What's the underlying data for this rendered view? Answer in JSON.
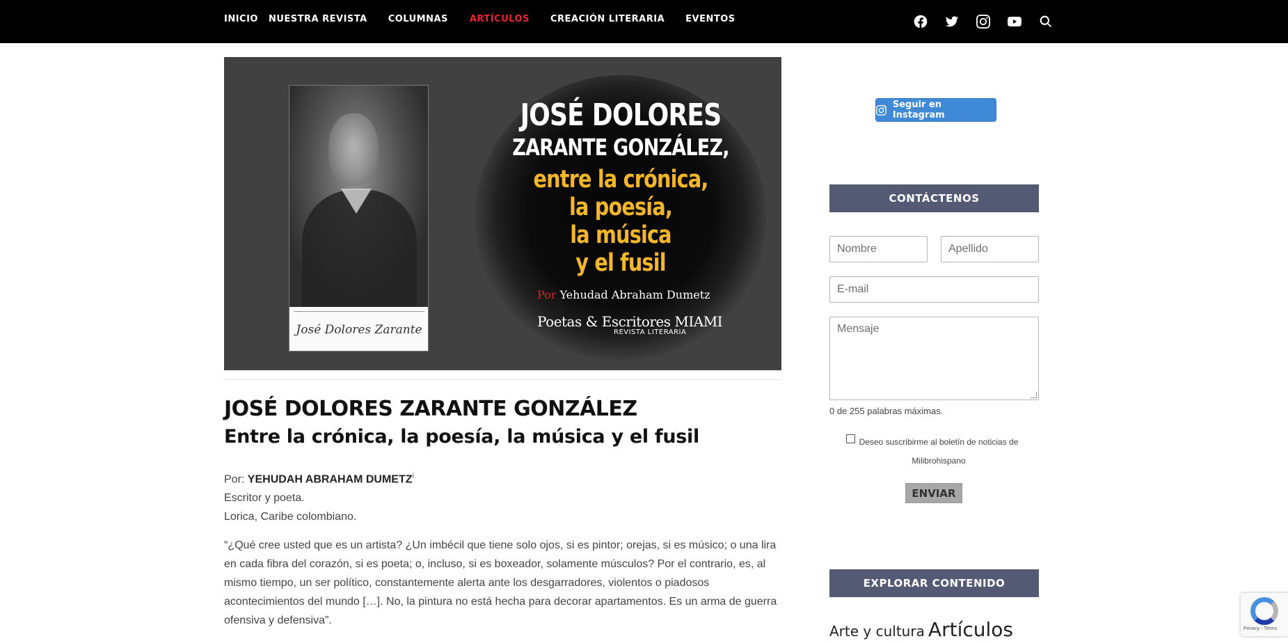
{
  "nav": {
    "items": [
      {
        "label": "INICIO",
        "active": false
      },
      {
        "label": "NUESTRA REVISTA",
        "active": false
      },
      {
        "label": "COLUMNAS",
        "active": false
      },
      {
        "label": "ARTÍCULOS",
        "active": true
      },
      {
        "label": "CREACIÓN LITERARIA",
        "active": false
      },
      {
        "label": "EVENTOS",
        "active": false
      }
    ],
    "icons": [
      "facebook-icon",
      "twitter-icon",
      "instagram-icon",
      "youtube-icon",
      "search-icon"
    ],
    "active_color": "#e3262f"
  },
  "hero": {
    "line1": "JOSÉ DOLORES",
    "line2": "ZARANTE GONZÁLEZ,",
    "line3": "entre la crónica,",
    "line4": "la poesía,",
    "line5": "la música",
    "line6": "y el fusil",
    "by_prefix": "Por",
    "by_name": "Yehudad Abraham Dumetz",
    "logo_main": "Poetas & Escritores MIAMI",
    "logo_sub": "REVISTA LITERARIA",
    "signature": "José Dolores Zarante",
    "accent_color": "#f5b629"
  },
  "article": {
    "title": "JOSÉ DOLORES ZARANTE GONZÁLEZ",
    "subtitle": "Entre la crónica, la poesía, la música y el fusil",
    "by_label": "Por:",
    "author": "YEHUDAH ABRAHAM DUMETZ",
    "author_note": "i",
    "role": "Escritor y poeta.",
    "location": "Lorica, Caribe colombiano.",
    "quote": "“¿Qué cree usted que es un artista? ¿Un imbécil que tiene solo ojos, si es pintor; orejas, si es músico; o una lira en cada fibra del corazón, si es poeta; o, incluso, si es boxeador, solamente músculos? Por el contrario, es, al mismo tiempo, un ser político, constantemente alerta ante los desgarradores, violentos o piadosos acontecimientos del mundo […]. No, la pintura no está hecha para decorar apartamentos. Es un arma de guerra ofensiva y defensiva”."
  },
  "sidebar": {
    "instagram_button": "Seguir en Instagram",
    "contact_heading": "CONTÁCTENOS",
    "form": {
      "nombre_placeholder": "Nombre",
      "apellido_placeholder": "Apellido",
      "email_placeholder": "E-mail",
      "mensaje_placeholder": "Mensaje",
      "counter": "0 de 255 palabras máximas.",
      "subscribe_label": "Deseo suscribirme al boletín de noticias de Milibrohispano",
      "subscribe_checked": false,
      "submit": "ENVIAR"
    },
    "explore_heading": "EXPLORAR CONTENIDO",
    "tag_small": "Arte y cultura",
    "tag_large": "Artículos",
    "heading_color": "#545a73",
    "button_color": "#3f89d6"
  },
  "recaptcha": {
    "terms": "Privacy - Terms"
  }
}
